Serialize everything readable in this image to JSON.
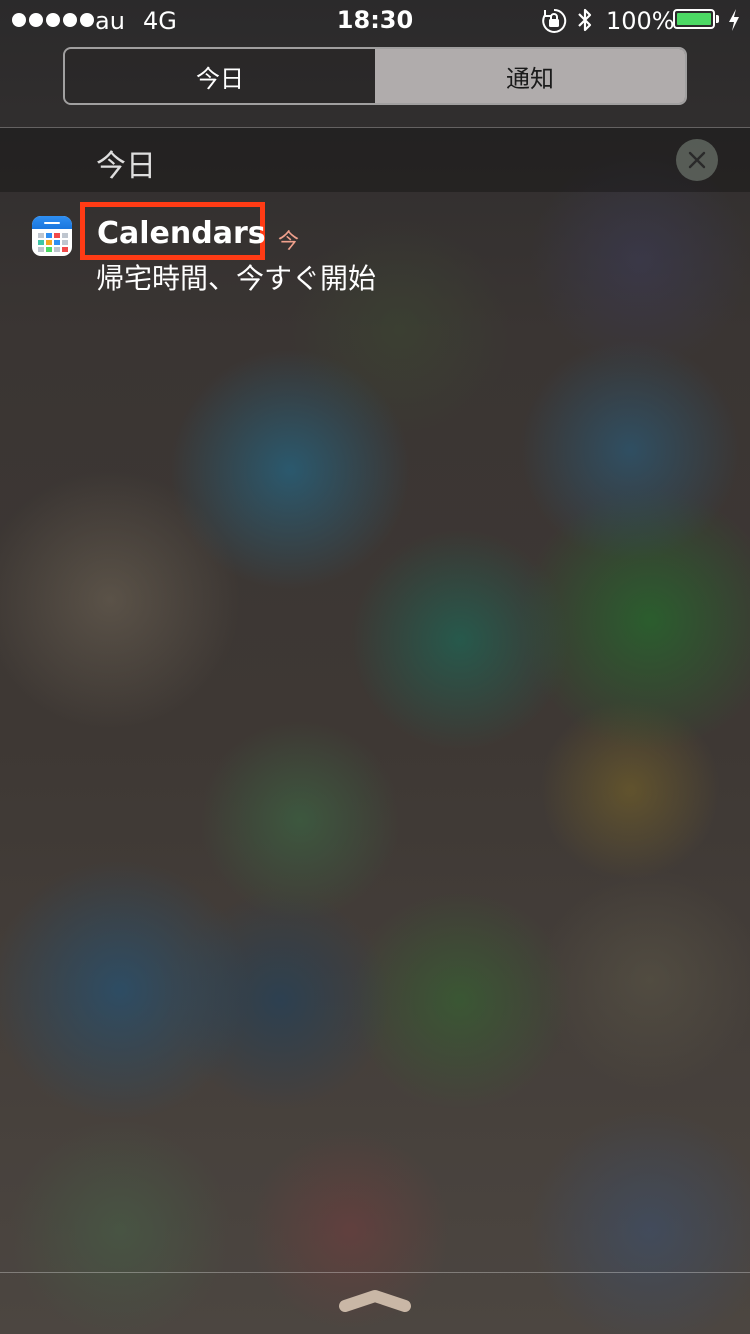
{
  "status_bar": {
    "carrier": "au",
    "network": "4G",
    "time": "18:30",
    "battery_percent": "100%",
    "battery_level": 1.0,
    "battery_color": "#4cd964",
    "icons": [
      "signal-dots",
      "rotation-lock-icon",
      "bluetooth-icon",
      "battery-icon",
      "charging-bolt-icon"
    ]
  },
  "tabs": [
    {
      "label": "今日",
      "active": true
    },
    {
      "label": "通知",
      "active": false
    }
  ],
  "section": {
    "title": "今日",
    "clear_icon": "close-icon"
  },
  "notification": {
    "app_name": "Calendars",
    "time": "今",
    "message": "帰宅時間、今すぐ開始",
    "app_icon": "calendars-app-icon",
    "highlight_color": "#ff3b15"
  },
  "bottom": {
    "grabber_icon": "chevron-up-grabber"
  }
}
